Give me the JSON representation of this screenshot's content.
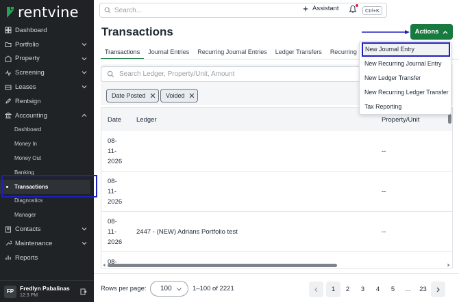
{
  "brand": {
    "name": "rentvine",
    "color": "#23a455"
  },
  "colors": {
    "sidebar_bg": "#1f2326",
    "accent_green": "#177a3e",
    "annotation_blue": "#1e1fbf"
  },
  "sidebar": {
    "items": [
      {
        "label": "Dashboard",
        "icon": "dashboard-icon"
      },
      {
        "label": "Portfolio",
        "icon": "folder-icon",
        "expandable": true
      },
      {
        "label": "Property",
        "icon": "building-icon",
        "expandable": true
      },
      {
        "label": "Screening",
        "icon": "screening-icon",
        "expandable": true
      },
      {
        "label": "Leases",
        "icon": "lease-icon",
        "expandable": true
      },
      {
        "label": "Rentsign",
        "icon": "pen-icon"
      },
      {
        "label": "Accounting",
        "icon": "bank-icon",
        "expandable": true,
        "expanded": true
      }
    ],
    "accounting_sub": [
      {
        "label": "Dashboard"
      },
      {
        "label": "Money In"
      },
      {
        "label": "Money Out"
      },
      {
        "label": "Banking"
      },
      {
        "label": "Transactions",
        "active": true
      },
      {
        "label": "Diagnostics"
      },
      {
        "label": "Manager"
      }
    ],
    "bottom_items": [
      {
        "label": "Contacts",
        "icon": "contacts-icon",
        "expandable": true
      },
      {
        "label": "Maintenance",
        "icon": "wrench-icon",
        "expandable": true
      },
      {
        "label": "Reports",
        "icon": "report-icon"
      }
    ],
    "user": {
      "initials": "FP",
      "name": "Fredlyn Pabalinas",
      "time": "12:3 PM"
    }
  },
  "topbar": {
    "search_placeholder": "Search...",
    "shortcut": "Ctrl+K",
    "assistant_label": "Assistant"
  },
  "page": {
    "title": "Transactions",
    "actions_label": "Actions"
  },
  "tabs": [
    {
      "label": "Transactions",
      "active": true
    },
    {
      "label": "Journal Entries"
    },
    {
      "label": "Recurring Journal Entries"
    },
    {
      "label": "Ledger Transfers"
    },
    {
      "label": "Recurring Le"
    }
  ],
  "filters": {
    "search_placeholder": "Search Ledger, Property/Unit, Amount",
    "chips": [
      {
        "label": "Date Posted"
      },
      {
        "label": "Voided"
      }
    ]
  },
  "table": {
    "columns": {
      "date": "Date",
      "ledger": "Ledger",
      "property": "Property/Unit"
    },
    "rows": [
      {
        "date": "08-\n11-\n2026",
        "ledger": "",
        "property": "--"
      },
      {
        "date": "08-\n11-\n2026",
        "ledger": "",
        "property": "--"
      },
      {
        "date": "08-\n11-\n2026",
        "ledger": "2447 - (NEW) Adrians Portfolio test",
        "property": "--"
      },
      {
        "date": "08-",
        "ledger": "",
        "property": ""
      }
    ]
  },
  "actions_menu": [
    {
      "label": "New Journal Entry",
      "selected": true
    },
    {
      "label": "New Recurring Journal Entry"
    },
    {
      "label": "New Ledger Transfer"
    },
    {
      "label": "New Recurring Ledger Transfer"
    },
    {
      "label": "Tax Reporting"
    }
  ],
  "footer": {
    "rows_per_page_label": "Rows per page:",
    "rows_per_page_value": "100",
    "range": "1–100 of 2221",
    "pages": [
      "1",
      "2",
      "3",
      "4",
      "5",
      "...",
      "23"
    ],
    "current_page": "1"
  }
}
